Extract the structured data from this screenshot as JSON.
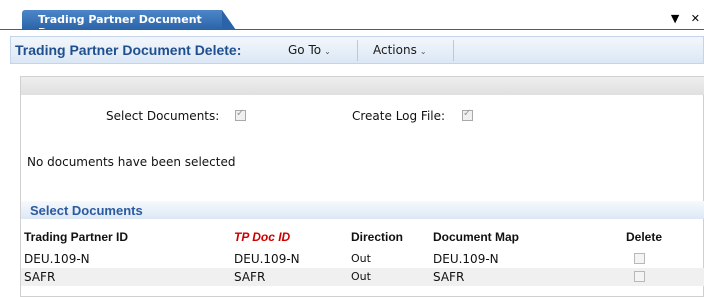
{
  "tab": {
    "label": "Trading Partner Document D...",
    "controls": [
      "▼",
      "✕"
    ]
  },
  "toolbar": {
    "title": "Trading Partner Document Delete:",
    "menus": [
      {
        "label": "Go To"
      },
      {
        "label": "Actions"
      }
    ]
  },
  "options": {
    "select_documents": {
      "label": "Select Documents:",
      "checked": true
    },
    "create_log_file": {
      "label": "Create Log File:",
      "checked": true
    }
  },
  "message": "No documents have been selected",
  "section": {
    "title": "Select Documents"
  },
  "table": {
    "headers": [
      "Trading Partner ID",
      "TP Doc ID",
      "Direction",
      "Document Map",
      "Delete"
    ],
    "rows": [
      {
        "trading_partner_id": "DEU.109-N",
        "tp_doc_id": "DEU.109-N",
        "direction": "Out",
        "document_map": "DEU.109-N",
        "delete": false
      },
      {
        "trading_partner_id": "SAFR",
        "tp_doc_id": "SAFR",
        "direction": "Out",
        "document_map": "SAFR",
        "delete": false
      }
    ]
  },
  "colors": {
    "accent": "#2b63a8",
    "title_blue": "#1f4f8f",
    "required_red": "#cc0000"
  }
}
